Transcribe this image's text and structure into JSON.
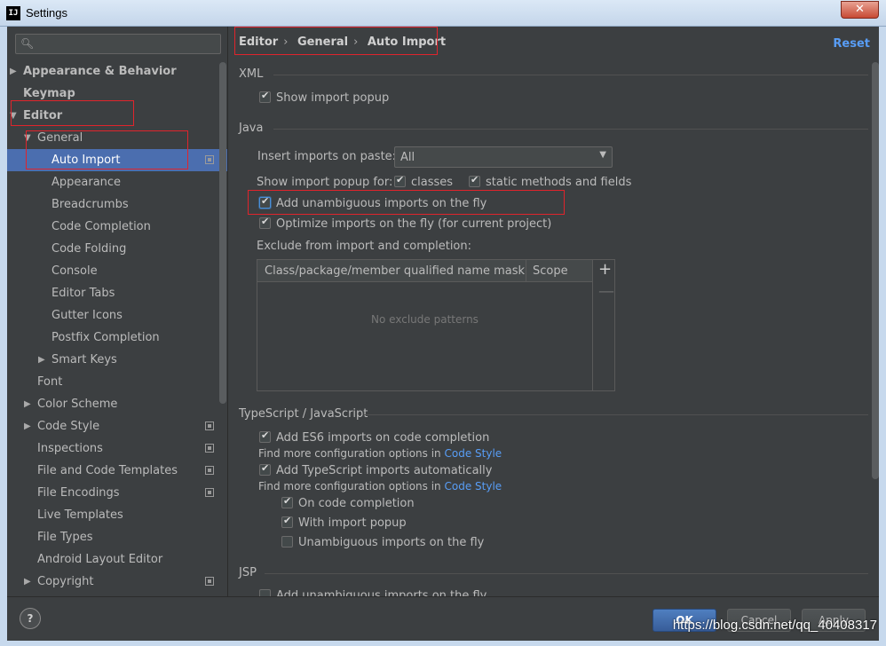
{
  "window": {
    "title": "Settings",
    "app_icon": "IJ",
    "close_label": "✕"
  },
  "breadcrumb": [
    "Editor",
    "General",
    "Auto Import"
  ],
  "reset_label": "Reset",
  "search": {
    "placeholder": ""
  },
  "tree": [
    {
      "label": "Appearance & Behavior",
      "bold": true,
      "arrow": "right"
    },
    {
      "label": "Keymap",
      "bold": true
    },
    {
      "label": "Editor",
      "bold": true,
      "arrow": "down"
    },
    {
      "label": "General",
      "arrow": "down"
    },
    {
      "label": "Auto Import",
      "selected": true,
      "project_icon": true
    },
    {
      "label": "Appearance"
    },
    {
      "label": "Breadcrumbs"
    },
    {
      "label": "Code Completion"
    },
    {
      "label": "Code Folding"
    },
    {
      "label": "Console"
    },
    {
      "label": "Editor Tabs"
    },
    {
      "label": "Gutter Icons"
    },
    {
      "label": "Postfix Completion"
    },
    {
      "label": "Smart Keys",
      "arrow": "right"
    },
    {
      "label": "Font"
    },
    {
      "label": "Color Scheme",
      "arrow": "right"
    },
    {
      "label": "Code Style",
      "arrow": "right",
      "project_icon": true
    },
    {
      "label": "Inspections",
      "project_icon": true
    },
    {
      "label": "File and Code Templates",
      "project_icon": true
    },
    {
      "label": "File Encodings",
      "project_icon": true
    },
    {
      "label": "Live Templates"
    },
    {
      "label": "File Types"
    },
    {
      "label": "Android Layout Editor"
    },
    {
      "label": "Copyright",
      "arrow": "right",
      "project_icon": true
    }
  ],
  "xml": {
    "section": "XML",
    "show_import_popup": {
      "label": "Show import popup",
      "checked": true
    }
  },
  "java": {
    "section": "Java",
    "insert_imports_label": "Insert imports on paste:",
    "insert_imports_value": "All",
    "show_popup_for_label": "Show import popup for:",
    "classes": {
      "label": "classes",
      "checked": true
    },
    "static_methods": {
      "label": "static methods and fields",
      "checked": true
    },
    "add_unambiguous": {
      "label": "Add unambiguous imports on the fly",
      "checked": true
    },
    "optimize_imports": {
      "label": "Optimize imports on the fly (for current project)",
      "checked": true
    },
    "exclude_label": "Exclude from import and completion:",
    "table": {
      "columns": [
        "Class/package/member qualified name mask",
        "Scope"
      ],
      "empty_text": "No exclude patterns",
      "add": "+",
      "remove": "—"
    }
  },
  "typescript": {
    "section": "TypeScript / JavaScript",
    "es6": {
      "label": "Add ES6 imports on code completion",
      "checked": true
    },
    "more_config_1": "Find more configuration options in",
    "code_style_link_1": "Code Style",
    "ts_auto": {
      "label": "Add TypeScript imports automatically",
      "checked": true
    },
    "more_config_2": "Find more configuration options in",
    "code_style_link_2": "Code Style",
    "on_completion": {
      "label": "On code completion",
      "checked": true
    },
    "with_popup": {
      "label": "With import popup",
      "checked": true
    },
    "unambiguous": {
      "label": "Unambiguous imports on the fly",
      "checked": false
    }
  },
  "jsp": {
    "section": "JSP",
    "add_unambiguous": {
      "label": "Add unambiguous imports on the fly",
      "checked": false
    }
  },
  "buttons": {
    "help": "?",
    "ok": "OK",
    "cancel": "Cancel",
    "apply": "Apply"
  },
  "watermark": "https://blog.csdn.net/qq_40408317",
  "colors": {
    "accent": "#4b6eaf",
    "link": "#589df6",
    "annotation": "#e0242c",
    "background": "#3c3f41"
  }
}
